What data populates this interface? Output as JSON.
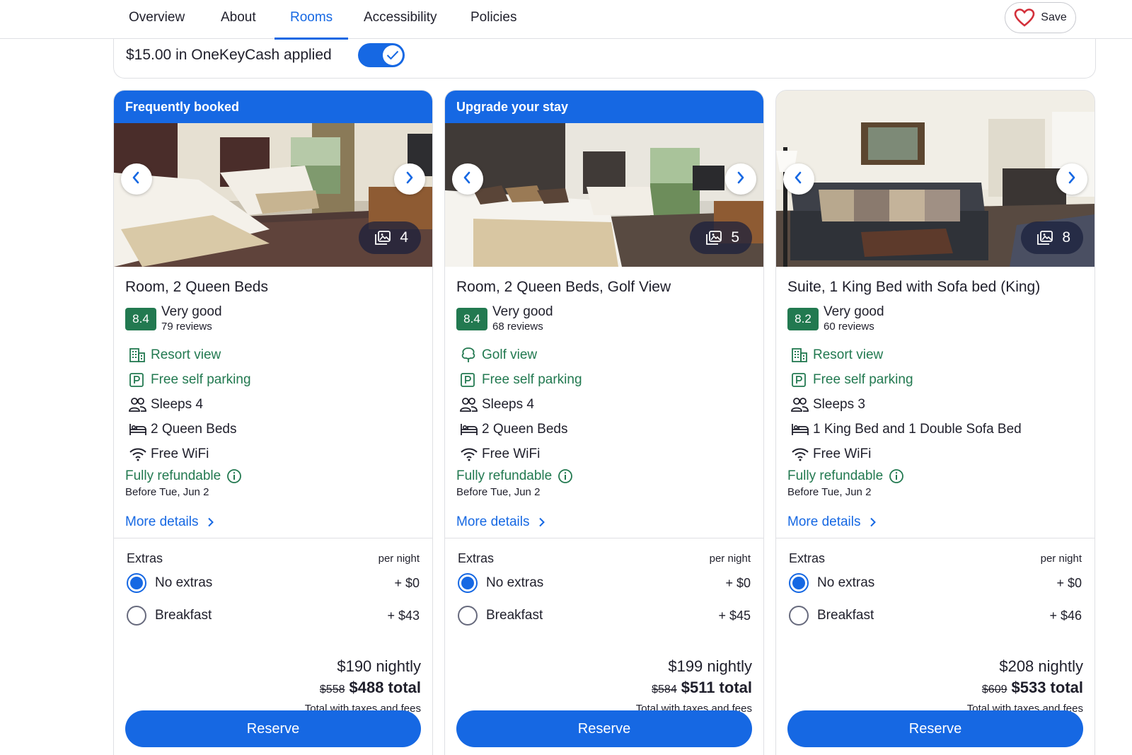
{
  "nav": {
    "tabs": [
      "Overview",
      "About",
      "Rooms",
      "Accessibility",
      "Policies"
    ],
    "active": "Rooms",
    "save_label": "Save"
  },
  "onekeycash": {
    "label": "$15.00 in OneKeyCash applied",
    "enabled": true
  },
  "colors": {
    "accent": "#1668e3",
    "rating": "#227950",
    "text": "#1f1f2b"
  },
  "cards": [
    {
      "banner": "Frequently booked",
      "photo_count": "4",
      "title": "Room, 2 Queen Beds",
      "score": "8.4",
      "rating_label": "Very good",
      "reviews": "79 reviews",
      "features": [
        {
          "icon": "building-icon",
          "text": "Resort view",
          "green": true
        },
        {
          "icon": "parking-icon",
          "text": "Free self parking",
          "green": true
        },
        {
          "icon": "people-icon",
          "text": "Sleeps 4",
          "green": false
        },
        {
          "icon": "bed-icon",
          "text": "2 Queen Beds",
          "green": false
        },
        {
          "icon": "wifi-icon",
          "text": "Free WiFi",
          "green": false
        }
      ],
      "refund": "Fully refundable",
      "refund_date": "Before Tue, Jun 2",
      "more": "More details",
      "extras_title": "Extras",
      "per_night": "per night",
      "options": [
        {
          "label": "No extras",
          "price": "+ $0",
          "selected": true
        },
        {
          "label": "Breakfast",
          "price": "+ $43",
          "selected": false
        }
      ],
      "nightly": "$190 nightly",
      "old_total": "$558",
      "total": "$488 total",
      "taxes": "Total with taxes and fees",
      "reserve": "Reserve"
    },
    {
      "banner": "Upgrade your stay",
      "photo_count": "5",
      "title": "Room, 2 Queen Beds, Golf View",
      "score": "8.4",
      "rating_label": "Very good",
      "reviews": "68 reviews",
      "features": [
        {
          "icon": "tree-icon",
          "text": "Golf view",
          "green": true
        },
        {
          "icon": "parking-icon",
          "text": "Free self parking",
          "green": true
        },
        {
          "icon": "people-icon",
          "text": "Sleeps 4",
          "green": false
        },
        {
          "icon": "bed-icon",
          "text": "2 Queen Beds",
          "green": false
        },
        {
          "icon": "wifi-icon",
          "text": "Free WiFi",
          "green": false
        }
      ],
      "refund": "Fully refundable",
      "refund_date": "Before Tue, Jun 2",
      "more": "More details",
      "extras_title": "Extras",
      "per_night": "per night",
      "options": [
        {
          "label": "No extras",
          "price": "+ $0",
          "selected": true
        },
        {
          "label": "Breakfast",
          "price": "+ $45",
          "selected": false
        }
      ],
      "nightly": "$199 nightly",
      "old_total": "$584",
      "total": "$511 total",
      "taxes": "Total with taxes and fees",
      "reserve": "Reserve"
    },
    {
      "banner": "",
      "photo_count": "8",
      "title": "Suite, 1 King Bed with Sofa bed (King)",
      "score": "8.2",
      "rating_label": "Very good",
      "reviews": "60 reviews",
      "features": [
        {
          "icon": "building-icon",
          "text": "Resort view",
          "green": true
        },
        {
          "icon": "parking-icon",
          "text": "Free self parking",
          "green": true
        },
        {
          "icon": "people-icon",
          "text": "Sleeps 3",
          "green": false
        },
        {
          "icon": "bed-icon",
          "text": "1 King Bed and 1 Double Sofa Bed",
          "green": false
        },
        {
          "icon": "wifi-icon",
          "text": "Free WiFi",
          "green": false
        }
      ],
      "refund": "Fully refundable",
      "refund_date": "Before Tue, Jun 2",
      "more": "More details",
      "extras_title": "Extras",
      "per_night": "per night",
      "options": [
        {
          "label": "No extras",
          "price": "+ $0",
          "selected": true
        },
        {
          "label": "Breakfast",
          "price": "+ $46",
          "selected": false
        }
      ],
      "nightly": "$208 nightly",
      "old_total": "$609",
      "total": "$533 total",
      "taxes": "Total with taxes and fees",
      "reserve": "Reserve"
    }
  ]
}
